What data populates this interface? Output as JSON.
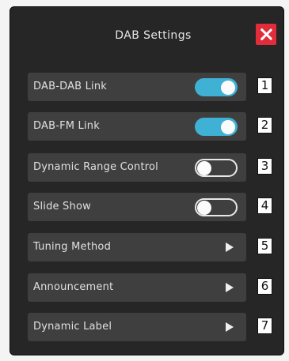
{
  "dialog": {
    "title": "DAB Settings",
    "close_icon": "close-icon"
  },
  "items": [
    {
      "label": "DAB-DAB Link",
      "control": "toggle",
      "state": "on",
      "callout": "1"
    },
    {
      "label": "DAB-FM Link",
      "control": "toggle",
      "state": "on",
      "callout": "2"
    },
    {
      "label": "Dynamic Range Control",
      "control": "toggle",
      "state": "off",
      "callout": "3"
    },
    {
      "label": "Slide Show",
      "control": "toggle",
      "state": "off",
      "callout": "4"
    },
    {
      "label": "Tuning Method",
      "control": "submenu",
      "callout": "5"
    },
    {
      "label": "Announcement",
      "control": "submenu",
      "callout": "6"
    },
    {
      "label": "Dynamic Label",
      "control": "submenu",
      "callout": "7"
    }
  ],
  "colors": {
    "panel_background": "#262626",
    "row_background": "#3f3f3f",
    "toggle_on": "#3fb1d4",
    "close_button": "#e12d3a"
  }
}
